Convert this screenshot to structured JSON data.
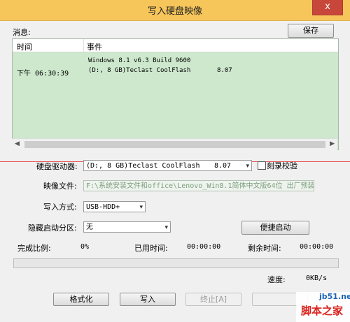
{
  "window": {
    "title": "写入硬盘映像",
    "close_glyph": "x"
  },
  "messages": {
    "label": "消息:",
    "save_button": "保存",
    "columns": [
      "时间",
      "事件"
    ],
    "rows": [
      {
        "time": "下午 06:30:39",
        "line1": "Windows 8.1 v6.3 Build 9600",
        "line2": "(D:, 8 GB)Teclast CoolFlash",
        "extra": "8.07"
      }
    ]
  },
  "form": {
    "drive_label": "硬盘驱动器:",
    "drive_value": "(D:, 8 GB)Teclast CoolFlash",
    "drive_size": "8.07",
    "verify_label": "刻录校验",
    "verify_checked": false,
    "image_label": "映像文件:",
    "image_path": "F:\\系统安装文件和office\\Lenovo_Win8.1简体中文版64位 出厂预装",
    "write_mode_label": "写入方式:",
    "write_mode_value": "USB-HDD+",
    "hide_partition_label": "隐藏启动分区:",
    "hide_partition_value": "无",
    "quick_boot_button": "便捷启动"
  },
  "status": {
    "completion_label": "完成比例:",
    "completion_value": "0%",
    "elapsed_label": "已用时间:",
    "elapsed_value": "00:00:00",
    "remaining_label": "剩余时间:",
    "remaining_value": "00:00:00",
    "progress_fraction": 0,
    "speed_label": "速度:",
    "speed_value": "0KB/s"
  },
  "buttons": {
    "format": "格式化",
    "write": "写入",
    "terminate": "终止[A]"
  },
  "watermark": {
    "site": "jb51.net",
    "cn": "脚本之家"
  },
  "colors": {
    "titlebar": "#f7c65a",
    "log_background": "#cde8cd",
    "progress_fill": "#06b025",
    "close": "#c7473b"
  }
}
